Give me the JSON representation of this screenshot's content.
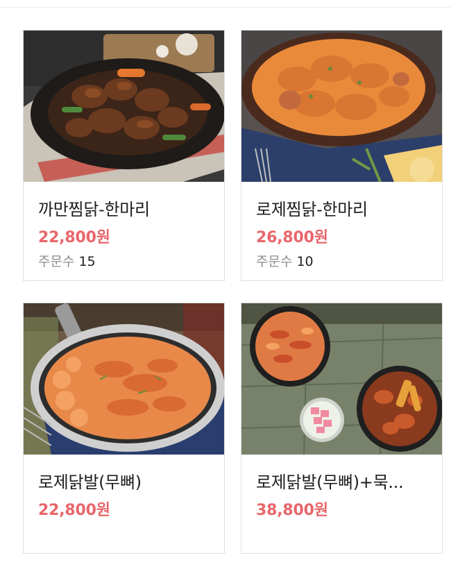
{
  "products": [
    {
      "name": "까만찜닭-한마리",
      "price": "22,800원",
      "order_label": "주문수",
      "order_count": "15",
      "image": "braised-chicken-photo"
    },
    {
      "name": "로제찜닭-한마리",
      "price": "26,800원",
      "order_label": "주문수",
      "order_count": "10",
      "image": "rose-chicken-photo"
    },
    {
      "name": "로제닭발(무뼈)",
      "price": "22,800원",
      "image": "rose-chicken-feet-photo"
    },
    {
      "name": "로제닭발(무뼈)+묵...",
      "price": "38,800원",
      "image": "chicken-feet-set-photo"
    }
  ],
  "colors": {
    "price": "#e8666a",
    "muted": "#8c8c8c",
    "border": "#dedede"
  }
}
